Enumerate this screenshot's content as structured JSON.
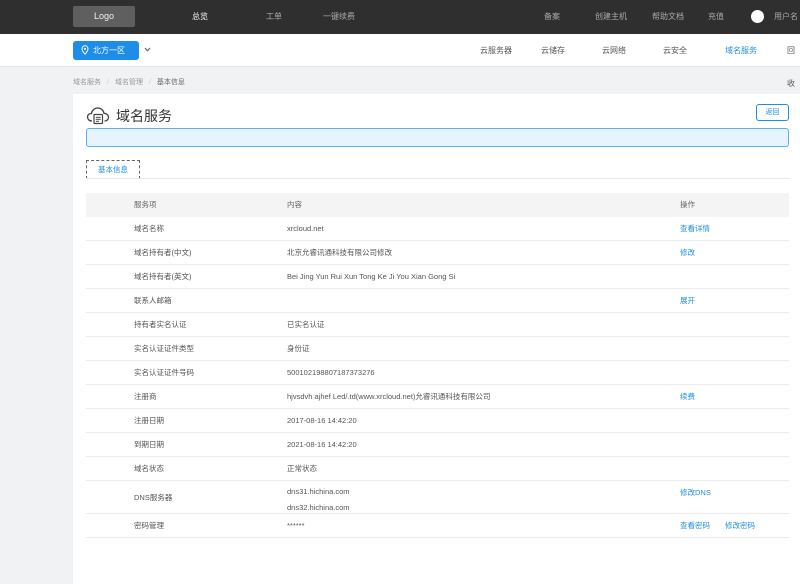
{
  "topbar": {
    "logo": "Logo",
    "nav": [
      "总览",
      "工单",
      "一键续费"
    ],
    "right": [
      "备案",
      "创建主机",
      "帮助文档",
      "充值"
    ],
    "username": "用户名"
  },
  "subbar": {
    "region": "北方一区",
    "nav": [
      "云服务器",
      "云储存",
      "云网络",
      "云安全",
      "域名服务",
      "回收"
    ]
  },
  "breadcrumb": [
    "域名服务",
    "域名管理",
    "基本信息"
  ],
  "page": {
    "title": "域名服务",
    "back": "返回",
    "tab": "基本信息"
  },
  "table": {
    "headers": [
      "服务项",
      "内容",
      "操作"
    ],
    "rows": [
      {
        "name": "域名名称",
        "content": "xrcloud.net",
        "action": "查看详情"
      },
      {
        "name": "域名持有者(中文)",
        "content": "北京允睿讯通科技有限公司修改",
        "action": "修改"
      },
      {
        "name": "域名持有者(英文)",
        "content": "Bei Jing Yun Rui Xun Tong Ke Ji You Xian Gong Si",
        "action": ""
      },
      {
        "name": "联系人邮箱",
        "content": "",
        "action": "展开"
      },
      {
        "name": "持有者实名认证",
        "content": "已实名认证",
        "action": ""
      },
      {
        "name": "实名认证证件类型",
        "content": "身份证",
        "action": ""
      },
      {
        "name": "实名认证证件号码",
        "content": "500102198807187373276",
        "action": ""
      },
      {
        "name": "注册商",
        "content": "hjvsdvh ajhef Led/.td(www.xrcloud.net)允睿讯通科技有限公司",
        "action": "续费"
      },
      {
        "name": "注册日期",
        "content": "2017-08-16 14:42:20",
        "action": ""
      },
      {
        "name": "到期日期",
        "content": "2021-08-16 14:42:20",
        "action": ""
      },
      {
        "name": "域名状态",
        "content": "正常状态",
        "action": ""
      }
    ],
    "dns": {
      "name": "DNS服务器",
      "content1": "dns31.hichina.com",
      "content2": "dns32.hichina.com",
      "action": "修改DNS"
    },
    "password": {
      "name": "密码管理",
      "content": "******",
      "action1": "查看密码",
      "action2": "修改密码"
    }
  },
  "colors": {
    "accent": "#1e8de8",
    "topbar": "#2f2f2f"
  }
}
